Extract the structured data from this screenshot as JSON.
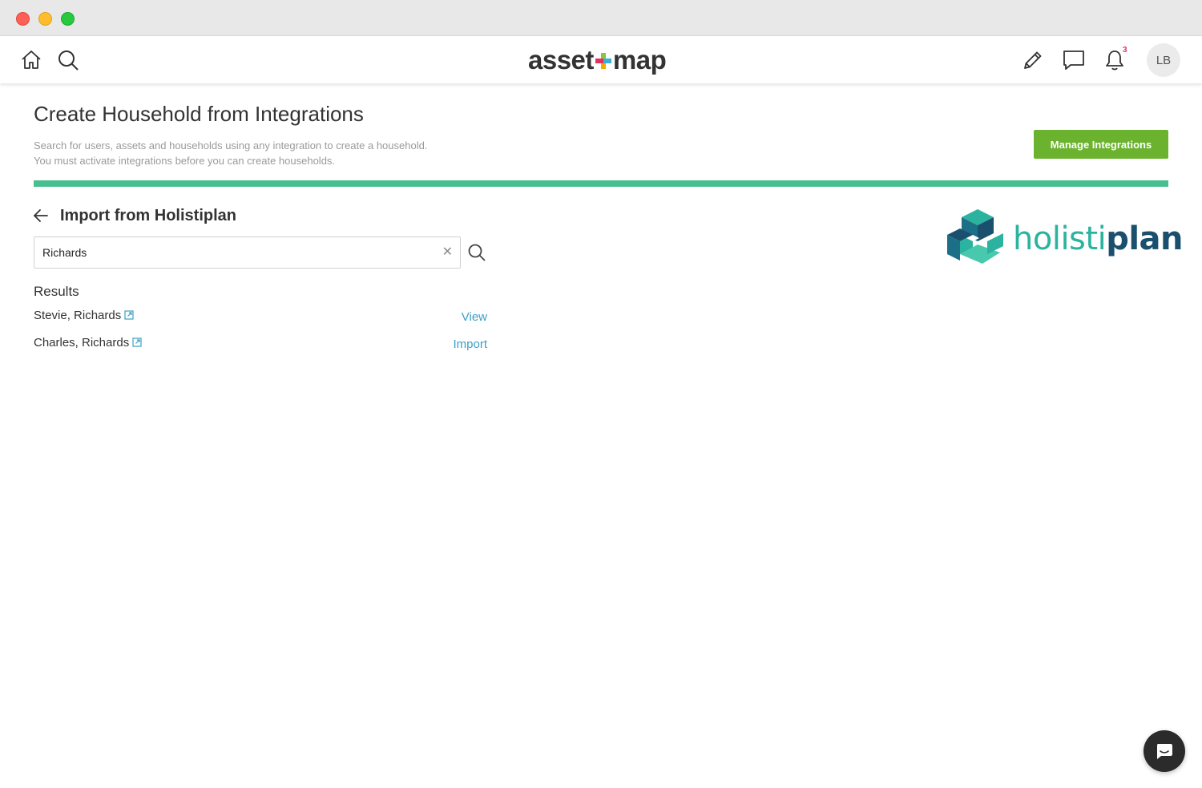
{
  "app": {
    "brand_left": "asset",
    "brand_right": "map"
  },
  "nav": {
    "notification_count": "3",
    "avatar_initials": "LB"
  },
  "header": {
    "title": "Create Household from Integrations",
    "subtitle_line1": "Search for users, assets and households using any integration to create a household.",
    "subtitle_line2": "You must activate integrations before you can create households.",
    "manage_button": "Manage Integrations",
    "accent_color": "#48bf91",
    "progress": 1.0
  },
  "import": {
    "heading": "Import from Holistiplan",
    "search_value": "Richards",
    "results_label": "Results",
    "results": [
      {
        "name": "Stevie, Richards",
        "action": "View"
      },
      {
        "name": "Charles, Richards",
        "action": "Import"
      }
    ]
  },
  "integration_logo": {
    "part1": "holisti",
    "part2": "plan"
  },
  "icons": [
    "home-icon",
    "search-icon",
    "pencil-icon",
    "chat-icon",
    "bell-icon",
    "back-arrow-icon",
    "clear-icon",
    "external-link-icon",
    "messenger-icon"
  ],
  "colors": {
    "brand_green": "#6bb32e",
    "link_blue": "#3a9fc6",
    "hp_teal": "#2bb3a0",
    "hp_navy": "#1b4f6e"
  }
}
